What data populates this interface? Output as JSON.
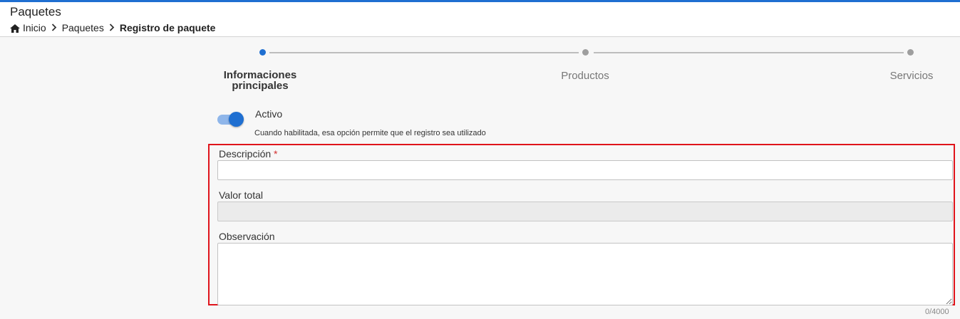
{
  "header": {
    "title": "Paquetes",
    "breadcrumb": {
      "home_icon": "home-icon",
      "items": [
        "Inicio",
        "Paquetes",
        "Registro de paquete"
      ]
    }
  },
  "stepper": {
    "steps": [
      {
        "label": "Informaciones principales",
        "active": true
      },
      {
        "label": "Productos",
        "active": false
      },
      {
        "label": "Servicios",
        "active": false
      }
    ]
  },
  "form": {
    "active_toggle": {
      "label": "Activo",
      "checked": true,
      "hint": "Cuando habilitada, esa opción permite que el registro sea utilizado"
    },
    "descripcion": {
      "label": "Descripción",
      "required_mark": "*",
      "value": ""
    },
    "valor_total": {
      "label": "Valor total",
      "value": ""
    },
    "observacion": {
      "label": "Observación",
      "value": "",
      "counter": "0/4000"
    }
  },
  "colors": {
    "accent": "#1f6fd1",
    "highlight": "#e0141b"
  }
}
